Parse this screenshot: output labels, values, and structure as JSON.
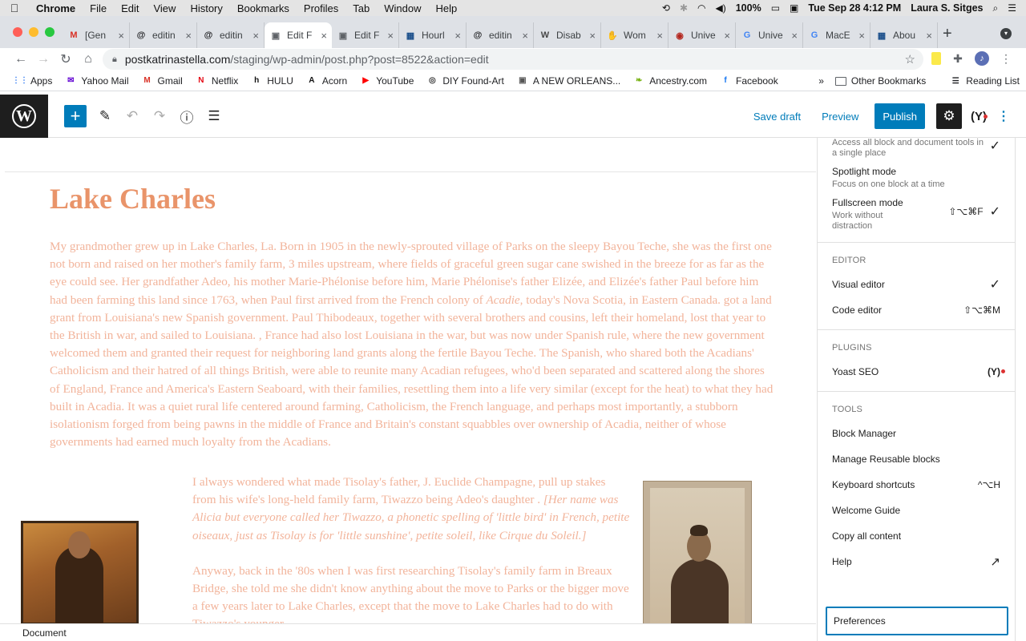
{
  "macos": {
    "apple": "",
    "menus": [
      "Chrome",
      "File",
      "Edit",
      "View",
      "History",
      "Bookmarks",
      "Profiles",
      "Tab",
      "Window",
      "Help"
    ],
    "battery": "100%",
    "datetime": "Tue Sep 28  4:12 PM",
    "user": "Laura S. Sitges"
  },
  "browser": {
    "tabs": [
      {
        "title": "[Gen",
        "favicon": "M",
        "color": "#d93025"
      },
      {
        "title": "editin",
        "favicon": "@",
        "color": "#202124"
      },
      {
        "title": "editin",
        "favicon": "@",
        "color": "#202124"
      },
      {
        "title": "Edit F",
        "favicon": "▣",
        "color": "#5f6368"
      },
      {
        "title": "Edit F",
        "favicon": "▣",
        "color": "#5f6368"
      },
      {
        "title": "Hourl",
        "favicon": "▦",
        "color": "#1a4e8a"
      },
      {
        "title": "editin",
        "favicon": "@",
        "color": "#202124"
      },
      {
        "title": "Disab",
        "favicon": "W",
        "color": "#464646"
      },
      {
        "title": "Wom",
        "favicon": "✋",
        "color": "#202124"
      },
      {
        "title": "Unive",
        "favicon": "◉",
        "color": "#b3261e"
      },
      {
        "title": "Unive",
        "favicon": "G",
        "color": "#4285f4"
      },
      {
        "title": "MacE",
        "favicon": "G",
        "color": "#4285f4"
      },
      {
        "title": "Abou",
        "favicon": "▦",
        "color": "#1a4e8a"
      }
    ],
    "active_tab_index": 3,
    "url_host": "postkatrinastella.com",
    "url_path": "/staging/wp-admin/post.php?post=8522&action=edit",
    "bookmarks": [
      {
        "label": "Apps",
        "icon": "⋮⋮",
        "color": "#4285f4"
      },
      {
        "label": "Yahoo Mail",
        "icon": "✉",
        "color": "#6001d2"
      },
      {
        "label": "Gmail",
        "icon": "M",
        "color": "#d93025"
      },
      {
        "label": "Netflix",
        "icon": "N",
        "color": "#e50914"
      },
      {
        "label": "HULU",
        "icon": "h",
        "color": "#111111"
      },
      {
        "label": "Acorn",
        "icon": "A",
        "color": "#111111"
      },
      {
        "label": "YouTube",
        "icon": "▶",
        "color": "#ff0000"
      },
      {
        "label": "DIY Found-Art",
        "icon": "◎",
        "color": "#333333"
      },
      {
        "label": "A NEW ORLEANS...",
        "icon": "▣",
        "color": "#555555"
      },
      {
        "label": "Ancestry.com",
        "icon": "❧",
        "color": "#7ab317"
      },
      {
        "label": "Facebook",
        "icon": "f",
        "color": "#1877f2"
      }
    ],
    "bookmarks_overflow": "»",
    "other_bookmarks": "Other Bookmarks",
    "reading_list": "Reading List"
  },
  "wp": {
    "save_draft": "Save draft",
    "preview": "Preview",
    "publish": "Publish",
    "post_title": "Lake Charles",
    "paragraph1_pre": "My grandmother grew up in Lake Charles, La.  Born in 1905 in the newly-sprouted village of Parks on the sleepy Bayou Teche, she was the first one not born and raised on her mother's family farm, 3 miles upstream, where fields of graceful green sugar cane swished in the breeze for as far as the eye could see.  Her grandfather Adeo, his mother Marie-Phélonise before him, Marie Phélonise's father Elizée, and Elizée's father Paul before him had been farming this land since 1763, when Paul first arrived from the French colony of ",
    "paragraph1_italic": "Acadie",
    "paragraph1_post": ", today's Nova Scotia, in Eastern Canada. got a land grant from Louisiana's new Spanish government.  Paul Thibodeaux, together with several brothers and cousins, left their homeland, lost that year to the British in war, and sailed to Louisiana.  , France had also lost Louisiana in the war, but was now under Spanish rule, where the new government welcomed them and granted their request for neighboring land grants along the fertile Bayou Teche.   The Spanish, who shared both the Acadians' Catholicism and their hatred of all things British, were able to reunite many Acadian refugees, who'd been separated and scattered along the shores of England, France and America's Eastern Seaboard, with their families, resettling them into a life very similar (except for the heat) to what they had built in Acadia.  It was a quiet rural life centered around farming, Catholicism, the French language, and perhaps most importantly, a stubborn isolationism forged from being pawns in the middle of France and Britain's constant squabbles over ownership of Acadia, neither of whose governments had earned much loyalty from the Acadians.",
    "col_para1": "I always wondered what made Tisolay's father, J. Euclide Champagne, pull up stakes from his wife's long-held family farm, Tiwazzo being Adeo's daughter . ",
    "col_para1_italic": "[Her name was Alicia but everyone called her Tiwazzo, a phonetic spelling of 'little bird' in French, petite oiseaux, just as Tisolay is for 'little sunshine', petite soleil, like Cirque du Soleil.]",
    "col_para2": "Anyway, back in the '80s when I was first researching Tisolay's family farm in Breaux Bridge, she told me she didn't know anything about the move to Parks or the bigger move a few years later to Lake Charles, except that the move to Lake Charles had to do with Tiwazzo's younger",
    "status_breadcrumb": "Document"
  },
  "menu": {
    "view_items": [
      {
        "label": "Access all block and document tools in a single place",
        "desc": "",
        "shortcut": "",
        "checked": true,
        "label_is_desc": true
      },
      {
        "label": "Spotlight mode",
        "desc": "Focus on one block at a time",
        "shortcut": "",
        "checked": false
      },
      {
        "label": "Fullscreen mode",
        "desc": "Work without distraction",
        "shortcut": "⇧⌥⌘F",
        "checked": true
      }
    ],
    "editor_heading": "EDITOR",
    "editor_items": [
      {
        "label": "Visual editor",
        "shortcut": "",
        "checked": true
      },
      {
        "label": "Code editor",
        "shortcut": "⇧⌥⌘M",
        "checked": false
      }
    ],
    "plugins_heading": "PLUGINS",
    "plugins_items": [
      {
        "label": "Yoast SEO"
      }
    ],
    "tools_heading": "TOOLS",
    "tools_items": [
      {
        "label": "Block Manager",
        "shortcut": ""
      },
      {
        "label": "Manage Reusable blocks",
        "shortcut": ""
      },
      {
        "label": "Keyboard shortcuts",
        "shortcut": "^⌥H"
      },
      {
        "label": "Welcome Guide",
        "shortcut": ""
      },
      {
        "label": "Copy all content",
        "shortcut": ""
      },
      {
        "label": "Help",
        "shortcut": ""
      }
    ],
    "preferences": "Preferences"
  },
  "colors": {
    "wp_blue": "#007cba",
    "title_color": "#e9946a",
    "body_text_color": "#f2b49b"
  }
}
